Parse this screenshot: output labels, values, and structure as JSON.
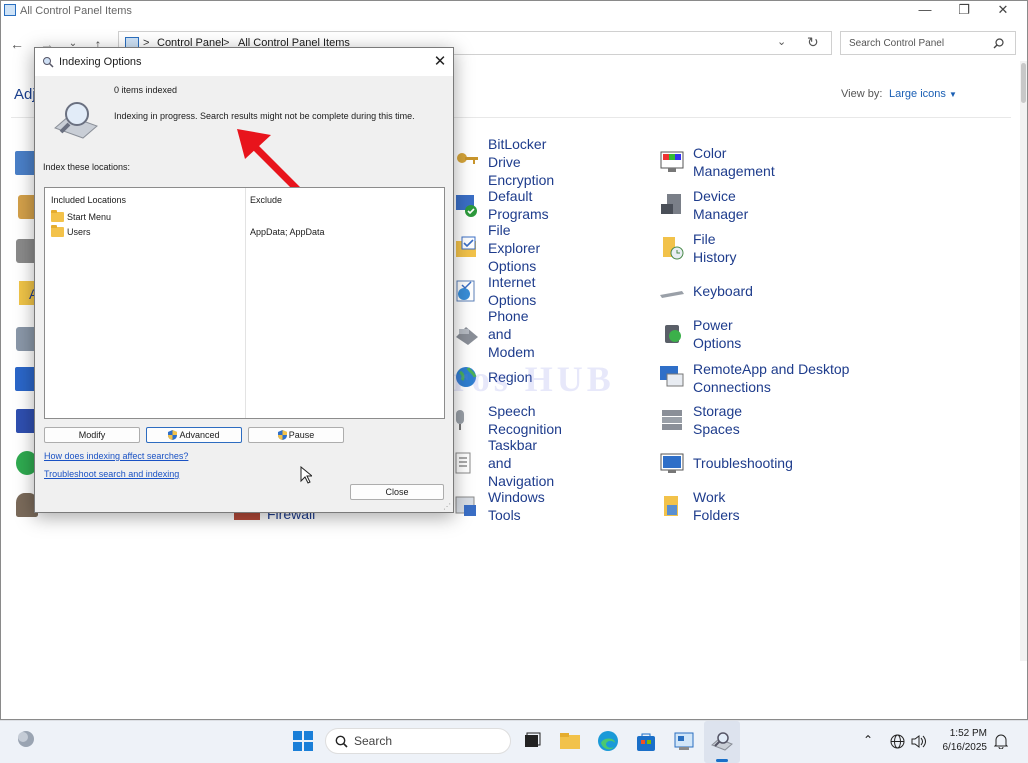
{
  "window": {
    "title": "All Control Panel Items",
    "caption_minimize": "—",
    "caption_maximize": "❐",
    "caption_close": "✕"
  },
  "nav": {
    "breadcrumb": [
      ">",
      "Control Panel",
      ">",
      "All Control Panel Items"
    ],
    "search_placeholder": "Search Control Panel"
  },
  "content": {
    "page_title": "Adj",
    "view_by_label": "View by:",
    "view_by_value": "Large icons",
    "right_col1": [
      {
        "label": "BitLocker Drive Encryption",
        "icon": "bitlocker-key-icon"
      },
      {
        "label": "Default Programs",
        "icon": "default-programs-icon"
      },
      {
        "label": "File Explorer Options",
        "icon": "file-explorer-options-icon"
      },
      {
        "label": "Internet Options",
        "icon": "internet-options-icon"
      },
      {
        "label": "Phone and Modem",
        "icon": "phone-modem-icon"
      },
      {
        "label": "Region",
        "icon": "region-globe-icon"
      },
      {
        "label": "Speech Recognition",
        "icon": "microphone-icon"
      },
      {
        "label": "Taskbar and Navigation",
        "icon": "taskbar-icon"
      },
      {
        "label": "Windows Tools",
        "icon": "windows-tools-icon"
      }
    ],
    "right_col2": [
      {
        "label": "Color Management",
        "icon": "color-management-icon"
      },
      {
        "label": "Device Manager",
        "icon": "device-manager-icon"
      },
      {
        "label": "File History",
        "icon": "file-history-icon"
      },
      {
        "label": "Keyboard",
        "icon": "keyboard-icon"
      },
      {
        "label": "Power Options",
        "icon": "power-options-icon"
      },
      {
        "label": "RemoteApp and Desktop Connections",
        "icon": "remoteapp-icon"
      },
      {
        "label": "Storage Spaces",
        "icon": "storage-spaces-icon"
      },
      {
        "label": "Troubleshooting",
        "icon": "troubleshooting-icon"
      },
      {
        "label": "Work Folders",
        "icon": "work-folders-icon"
      }
    ],
    "partial_items": [
      {
        "label": "A",
        "icon": "autoplay-icon"
      },
      {
        "label": "Firewall",
        "icon": "firewall-icon"
      }
    ]
  },
  "dialog": {
    "title": "Indexing Options",
    "close": "✕",
    "items_indexed": "0 items indexed",
    "status": "Indexing in progress. Search results might not be complete during this time.",
    "locations_label": "Index these locations:",
    "col_included": "Included Locations",
    "col_exclude": "Exclude",
    "rows": [
      {
        "location": "Start Menu",
        "exclude": ""
      },
      {
        "location": "Users",
        "exclude": "AppData; AppData"
      }
    ],
    "btn_modify": "Modify",
    "btn_advanced": "Advanced",
    "btn_pause": "Pause",
    "link_affect": "How does indexing affect searches?",
    "link_troubleshoot": "Troubleshoot search and indexing",
    "btn_close": "Close"
  },
  "watermark": "IT Pros HUB",
  "taskbar": {
    "search_label": "Search",
    "time": "1:52 PM",
    "date": "6/16/2025"
  },
  "colors": {
    "link": "#1e3c8c",
    "accent": "#1a5fb4",
    "arrow": "#e8141c"
  }
}
